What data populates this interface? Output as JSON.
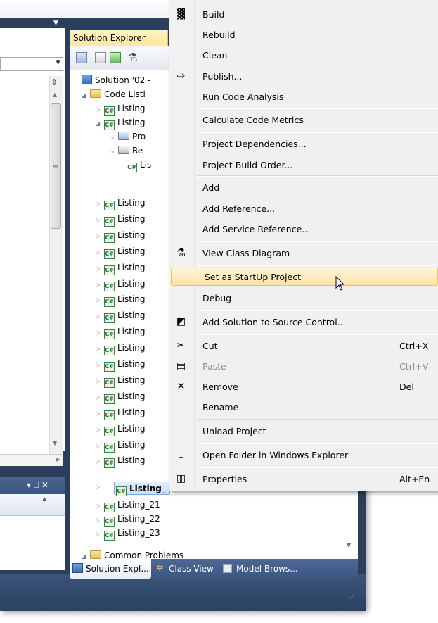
{
  "colors": {
    "frame": "#2b3f5c",
    "menu_bg": "#f0f0f0",
    "hover": "#fbe5a5",
    "selection": "#c9defa",
    "cs_icon": "#2f8a3f"
  },
  "solution_explorer": {
    "title": "Solution Explorer",
    "tree": {
      "solution": "Solution '02 -",
      "code_folder": "Code Listi",
      "items": [
        {
          "label": "Listing",
          "expanded": false
        },
        {
          "label": "Listing",
          "expanded": true
        }
      ],
      "children": [
        {
          "label": "Pro",
          "icon": "properties-icon"
        },
        {
          "label": "Re",
          "icon": "references-icon"
        },
        {
          "label": "Lis",
          "icon": "cs-file-icon"
        }
      ],
      "listings": [
        "Listing",
        "Listing",
        "Listing",
        "Listing",
        "Listing",
        "Listing",
        "Listing",
        "Listing",
        "Listing",
        "Listing",
        "Listing",
        "Listing",
        "Listing",
        "Listing",
        "Listing",
        "Listing",
        "Listing"
      ],
      "selected": "Listing_",
      "after": [
        "Listing_21",
        "Listing_22",
        "Listing_23"
      ],
      "partial_folder": "Common Problems"
    },
    "bottom_tabs": [
      "Solution Expl...",
      "Class View",
      "Model Brows..."
    ]
  },
  "lower_pane": {
    "controls": "▾ ⎕ ✕"
  },
  "context_menu": {
    "items": [
      {
        "label": "Build",
        "icon": "build-icon",
        "glyph": "▓"
      },
      {
        "label": "Rebuild"
      },
      {
        "label": "Clean"
      },
      {
        "label": "Publish...",
        "icon": "publish-icon",
        "glyph": "⇨"
      },
      {
        "label": "Run Code Analysis"
      },
      {
        "label": "Calculate Code Metrics"
      },
      {
        "label": "Project Dependencies..."
      },
      {
        "label": "Project Build Order..."
      },
      {
        "label": "Add"
      },
      {
        "label": "Add Reference..."
      },
      {
        "label": "Add Service Reference..."
      },
      {
        "label": "View Class Diagram",
        "icon": "class-diagram-icon",
        "glyph": "⚗"
      },
      {
        "label": "Set as StartUp Project"
      },
      {
        "label": "Debug"
      },
      {
        "label": "Add Solution to Source Control...",
        "icon": "source-control-icon",
        "glyph": "◩"
      },
      {
        "label": "Cut",
        "shortcut": "Ctrl+X",
        "icon": "cut-icon",
        "glyph": "✂"
      },
      {
        "label": "Paste",
        "shortcut": "Ctrl+V",
        "icon": "paste-icon",
        "glyph": "▤",
        "disabled": true
      },
      {
        "label": "Remove",
        "shortcut": "Del",
        "icon": "remove-icon",
        "glyph": "✕"
      },
      {
        "label": "Rename"
      },
      {
        "label": "Unload Project"
      },
      {
        "label": "Open Folder in Windows Explorer",
        "icon": "open-folder-icon",
        "glyph": "▫"
      },
      {
        "label": "Properties",
        "shortcut": "Alt+En",
        "icon": "properties-icon",
        "glyph": "▥"
      }
    ]
  }
}
